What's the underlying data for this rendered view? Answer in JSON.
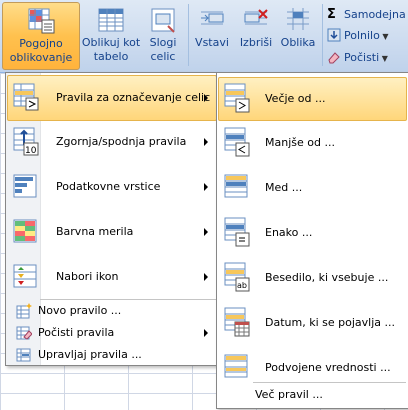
{
  "ribbon": {
    "pogojno": [
      "Pogojno",
      "oblikovanje"
    ],
    "oblikuj_kot_tabelo": [
      "Oblikuj kot",
      "tabelo"
    ],
    "slogi_celic": [
      "Slogi",
      "celic"
    ],
    "vstavi": "Vstavi",
    "izbrisi": "Izbriši",
    "oblika": "Oblika",
    "samodejna": "Samodejna",
    "polnilo": "Polnilo",
    "pocisti": "Počisti"
  },
  "menu": {
    "items": [
      {
        "label": "Pravila za označevanje celic",
        "icon": "highlight-rules-icon"
      },
      {
        "label": "Zgornja/spodnja pravila",
        "icon": "top-bottom-rules-icon"
      },
      {
        "label": "Podatkovne vrstice",
        "icon": "data-bars-icon"
      },
      {
        "label": "Barvna merila",
        "icon": "color-scales-icon"
      },
      {
        "label": "Nabori ikon",
        "icon": "icon-sets-icon"
      }
    ],
    "small_items": [
      {
        "label": "Novo pravilo ...",
        "icon": "new-rule-icon"
      },
      {
        "label": "Počisti pravila",
        "icon": "clear-rules-icon"
      },
      {
        "label": "Upravljaj pravila ...",
        "icon": "manage-rules-icon"
      }
    ]
  },
  "submenu": {
    "items": [
      {
        "label": "Večje od ...",
        "icon": "greater-than-icon"
      },
      {
        "label": "Manjše od ...",
        "icon": "less-than-icon"
      },
      {
        "label": "Med ...",
        "icon": "between-icon"
      },
      {
        "label": "Enako ...",
        "icon": "equal-to-icon"
      },
      {
        "label": "Besedilo, ki vsebuje ...",
        "icon": "text-contains-icon"
      },
      {
        "label": "Datum, ki se pojavlja ...",
        "icon": "date-occurring-icon"
      },
      {
        "label": "Podvojene vrednosti ...",
        "icon": "duplicate-values-icon"
      }
    ],
    "more": "Več pravil ..."
  }
}
